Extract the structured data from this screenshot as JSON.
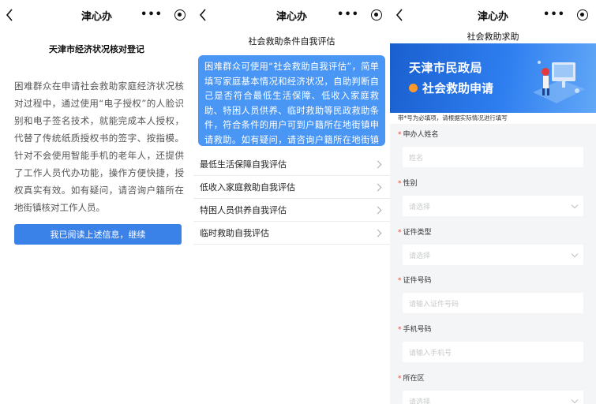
{
  "app_title": "津心办",
  "panel1": {
    "title": "天津市经济状况核对登记",
    "body": "困难群众在申请社会救助家庭经济状况核对过程中，通过使用“电子授权”的人脸识别和电子签名技术，就能完成本人授权，代替了传统纸质授权书的签字、按指模。针对不会使用智能手机的老年人，还提供了工作人员代办功能，操作方便快捷，授权真实有效。如有疑问，请咨询户籍所在地街镇核对工作人员。",
    "button_label": "我已阅读上述信息，继续"
  },
  "panel2": {
    "title": "社会救助条件自我评估",
    "info": "困难群众可使用“社会救助自我评估”，简单填写家庭基本情况和经济状况，自助判断自己是否符合最低生活保障、低收入家庭救助、特困人员供养、临时救助等民政救助条件，符合条件的用户可到户籍所在地街镇申请救助。如有疑问，请咨询户籍所在地街镇民政部门。",
    "menu": [
      {
        "label": "最低生活保障自我评估"
      },
      {
        "label": "低收入家庭救助自我评估"
      },
      {
        "label": "特困人员供养自我评估"
      },
      {
        "label": "临时救助自我评估"
      }
    ]
  },
  "panel3": {
    "title": "社会救助求助",
    "banner_line1": "天津市民政局",
    "banner_line2": "社会救助申请",
    "hint": "带*号为必填项，请根据实际情况进行填写",
    "required_mark": "*",
    "fields": [
      {
        "label": "申办人姓名",
        "placeholder": "姓名",
        "type": "text"
      },
      {
        "label": "性别",
        "placeholder": "请选择",
        "type": "select"
      },
      {
        "label": "证件类型",
        "placeholder": "请选择",
        "type": "select"
      },
      {
        "label": "证件号码",
        "placeholder": "请输入证件号码",
        "type": "text"
      },
      {
        "label": "手机号码",
        "placeholder": "请输入手机号",
        "type": "text"
      },
      {
        "label": "所在区",
        "placeholder": "请选择",
        "type": "select"
      }
    ]
  },
  "colors": {
    "primary_button": "#3b82e8",
    "info_box": "#4a96f5",
    "required": "#e3483a",
    "banner_start": "#1a5fcf",
    "banner_end": "#62a8f7"
  },
  "icons": {
    "back": "chevron-left-icon",
    "more": "more-dots-icon",
    "mini_program": "target-circle-icon",
    "menu_arrow": "chevron-right-icon",
    "select_arrow": "chevron-down-icon"
  }
}
